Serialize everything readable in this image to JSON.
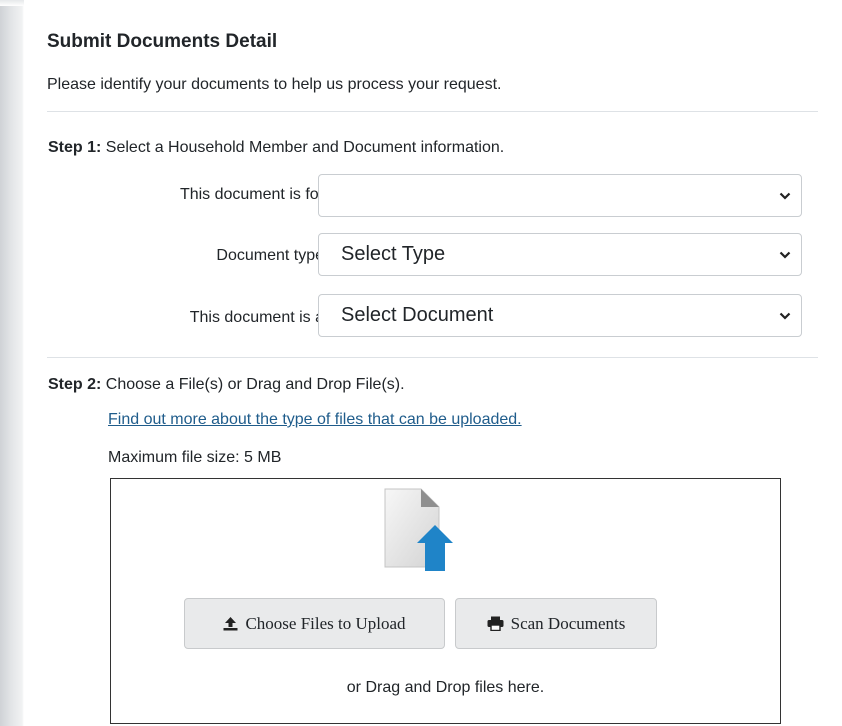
{
  "page": {
    "title": "Submit Documents Detail",
    "subtitle": "Please identify your documents to help us process your request."
  },
  "step1": {
    "prefix": "Step 1:",
    "text": " Select a Household Member and Document information.",
    "fields": [
      {
        "label": "This document is for",
        "value": ""
      },
      {
        "label": "Document type",
        "value": "Select Type"
      },
      {
        "label": "This document is a",
        "value": "Select Document"
      }
    ]
  },
  "step2": {
    "prefix": "Step 2:",
    "text": " Choose a File(s) or Drag and Drop File(s).",
    "link": "Find out more about the type of files that can be uploaded.",
    "max_size": "Maximum file size: 5 MB",
    "choose_label": "Choose Files to Upload",
    "scan_label": "Scan Documents",
    "drag_text": "or Drag and Drop files here."
  },
  "icons": {
    "file": "file-upload-icon",
    "upload": "upload-icon",
    "print": "print-icon",
    "chevron": "chevron-down-icon"
  },
  "colors": {
    "link": "#1f5c8b",
    "upload_arrow": "#1f84c8",
    "button_bg": "#e9eaeb"
  }
}
